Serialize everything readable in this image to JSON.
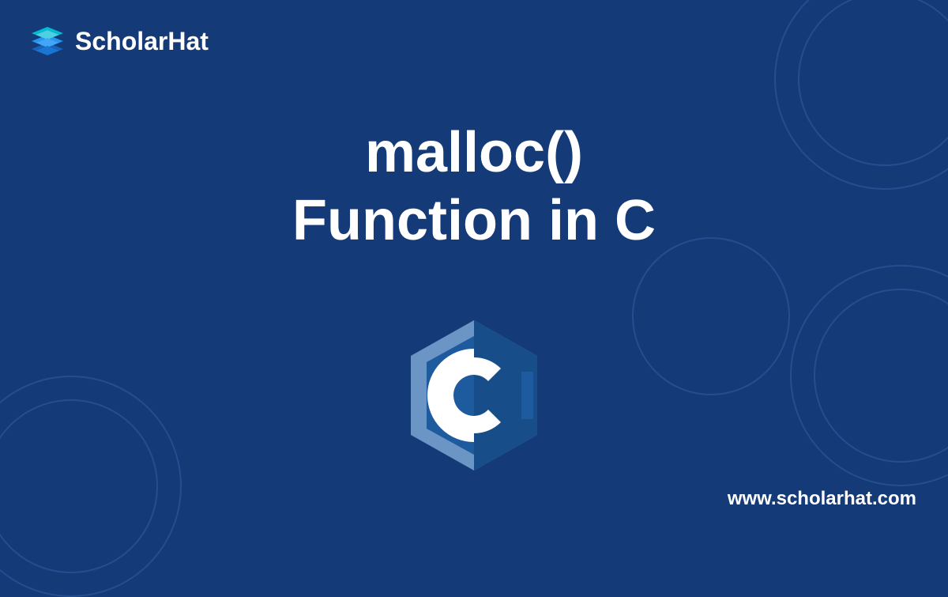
{
  "logo": {
    "brand_name": "ScholarHat"
  },
  "title": {
    "line1": "malloc()",
    "line2": "Function in C"
  },
  "footer": {
    "url": "www.scholarhat.com"
  },
  "colors": {
    "background": "#153a78",
    "text": "#ffffff",
    "logo_cyan": "#00bcd4",
    "logo_blue": "#1976d2",
    "c_logo_light": "#6a95c4",
    "c_logo_dark": "#1e5a9e"
  }
}
